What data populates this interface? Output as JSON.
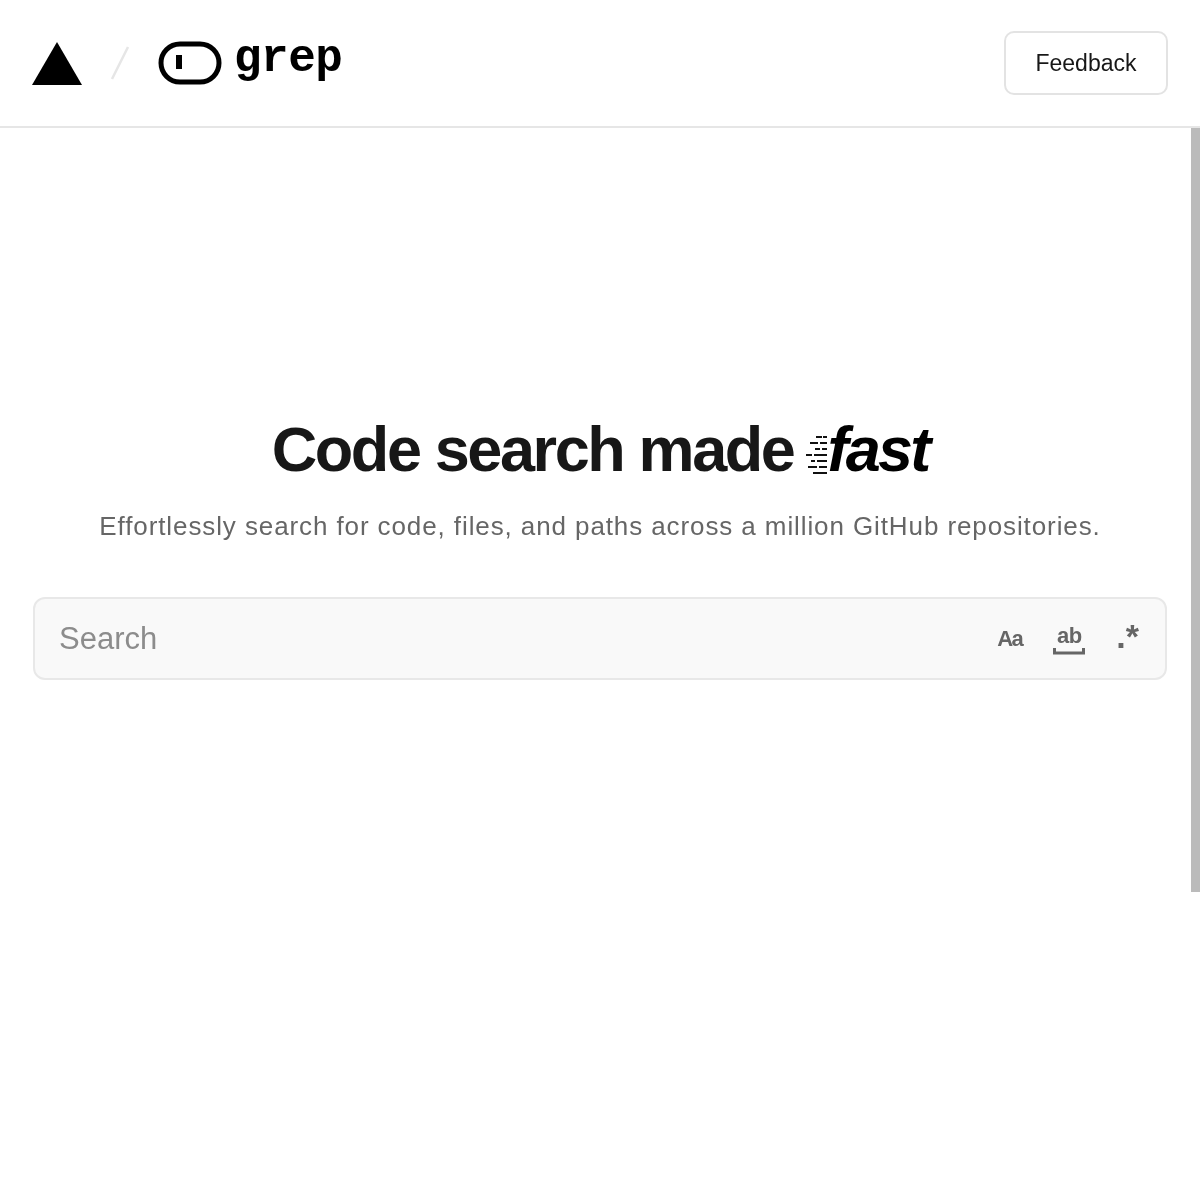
{
  "header": {
    "brand": "grep",
    "feedback_button": "Feedback"
  },
  "hero": {
    "headline": "Code search made",
    "emphasis": "fast",
    "subtitle": "Effortlessly search for code, files, and paths across a million GitHub repositories."
  },
  "search": {
    "placeholder": "Search",
    "toggles": [
      {
        "kind": "match-case",
        "label": "Aa",
        "on": false
      },
      {
        "kind": "whole-word",
        "label": "ab",
        "on": false
      },
      {
        "kind": "regex",
        "label": ".*",
        "on": false
      }
    ]
  }
}
